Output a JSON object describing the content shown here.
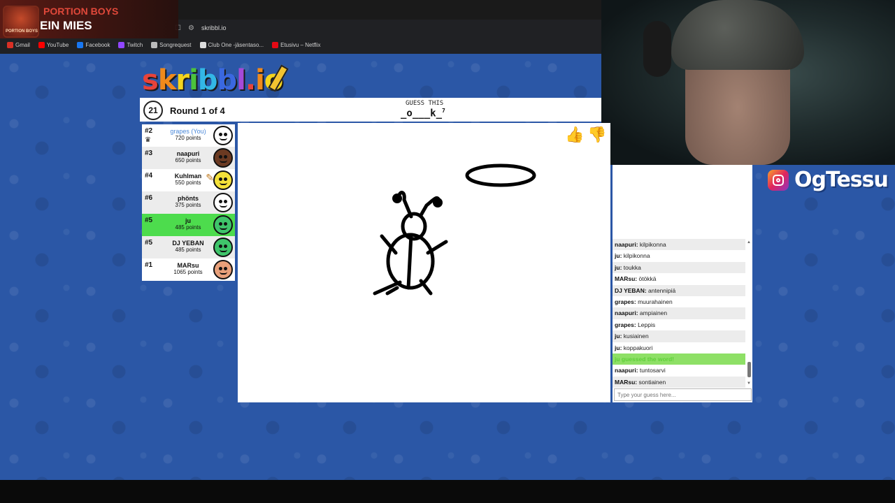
{
  "browser": {
    "url": "skribbl.io",
    "bookmarks": [
      {
        "label": "Gmail",
        "color": "#d93025"
      },
      {
        "label": "YouTube",
        "color": "#ff0000"
      },
      {
        "label": "Facebook",
        "color": "#1877f2"
      },
      {
        "label": "Twitch",
        "color": "#9146ff"
      },
      {
        "label": "Songrequest",
        "color": "#bbbbbb"
      },
      {
        "label": "Club One -jäsentaso...",
        "color": "#dddddd"
      },
      {
        "label": "Etusivu – Netflix",
        "color": "#e50914"
      }
    ]
  },
  "overlay": {
    "title": "PORTION BOYS",
    "subtitle": "EIN MIES",
    "logo_text": "PORTION BOYS",
    "instagram": "OgTessu"
  },
  "game": {
    "logo": [
      "s",
      "k",
      "r",
      "i",
      "b",
      "b",
      "l",
      ".",
      "i",
      "o"
    ],
    "logo_colors": [
      "#e8433a",
      "#f08a1c",
      "#f4d41e",
      "#4cc33c",
      "#33b7e6",
      "#3a68e0",
      "#a54ad8",
      "#e8433a",
      "#f08a1c",
      "#f4d41e"
    ],
    "timer": "21",
    "round": "Round 1 of 4",
    "guess_label": "GUESS THIS",
    "word": "_o___k_",
    "word_length": "7"
  },
  "players": [
    {
      "rank": "#2",
      "name": "grapes (You)",
      "points": "720 points",
      "me": true,
      "crown": true,
      "avatar_color": "#ffffff",
      "guessed": false
    },
    {
      "rank": "#3",
      "name": "naapuri",
      "points": "650 points",
      "avatar_color": "#6b3a22",
      "guessed": false
    },
    {
      "rank": "#4",
      "name": "Kuhlman",
      "points": "550 points",
      "avatar_color": "#f4e13a",
      "drawing": true,
      "guessed": false
    },
    {
      "rank": "#6",
      "name": "phönts",
      "points": "375 points",
      "avatar_color": "#ffffff",
      "guessed": false
    },
    {
      "rank": "#5",
      "name": "ju",
      "points": "485 points",
      "avatar_color": "#3fc46a",
      "guessed": true
    },
    {
      "rank": "#5",
      "name": "DJ YEBAN",
      "points": "485 points",
      "avatar_color": "#3fc46a",
      "guessed": false
    },
    {
      "rank": "#1",
      "name": "MARsu",
      "points": "1065 points",
      "avatar_color": "#e8a07a",
      "guessed": false
    }
  ],
  "chat": {
    "messages": [
      {
        "who": "naapuri",
        "text": "kilpikonna"
      },
      {
        "who": "ju",
        "text": "kilpikonna"
      },
      {
        "who": "ju",
        "text": "toukka"
      },
      {
        "who": "MARsu",
        "text": "ötökkä"
      },
      {
        "who": "DJ YEBAN",
        "text": "antennipiä"
      },
      {
        "who": "grapes",
        "text": "muurahainen"
      },
      {
        "who": "naapuri",
        "text": "ampiainen"
      },
      {
        "who": "grapes",
        "text": "Leppis"
      },
      {
        "who": "ju",
        "text": "kusiainen"
      },
      {
        "who": "ju",
        "text": "koppakuori"
      },
      {
        "who": "",
        "text": "ju guessed the word!",
        "system": true
      },
      {
        "who": "naapuri",
        "text": "tuntosarvi"
      },
      {
        "who": "MARsu",
        "text": "sontiainen"
      }
    ],
    "placeholder": "Type your guess here..."
  }
}
